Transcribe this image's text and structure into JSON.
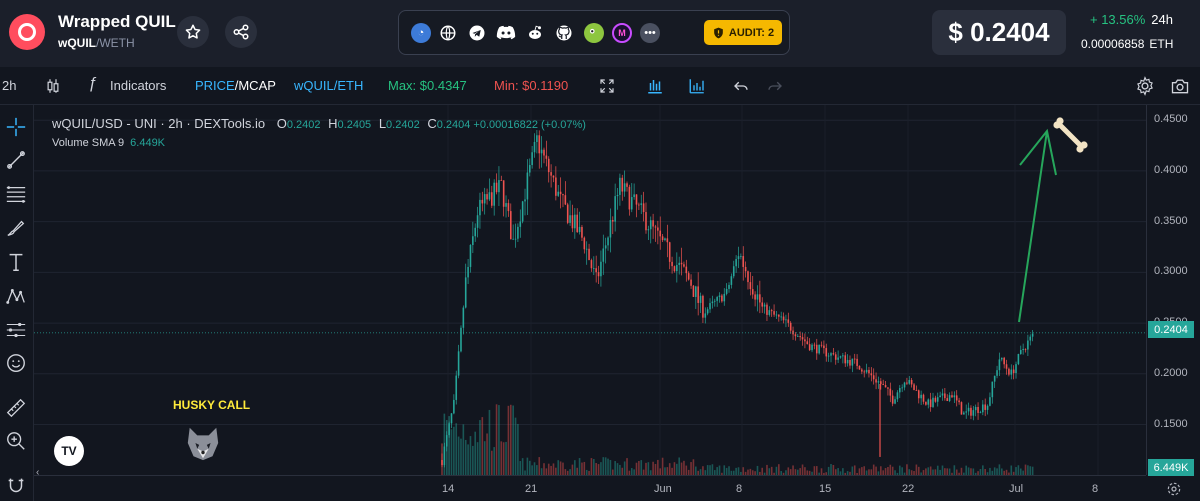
{
  "header": {
    "token_name": "Wrapped QUIL",
    "base_symbol": "wQUIL",
    "separator": "/",
    "quote_symbol": "WETH",
    "audit_label": "AUDIT: 2",
    "price": "$ 0.2404",
    "change": "+ 13.56%",
    "change_period": "24h",
    "eth_price": "0.00006858",
    "eth_symbol": "ETH",
    "social_icons": [
      "dextools-icon",
      "globe-icon",
      "telegram-icon",
      "discord-icon",
      "reddit-icon",
      "github-icon",
      "coingecko-icon",
      "dapp-icon",
      "more-icon"
    ]
  },
  "toolbar": {
    "interval": "2h",
    "indicators_label": "Indicators",
    "price_label": "PRICE",
    "mcap_label": "/MCAP",
    "pair_label": "wQUIL/ETH",
    "max_label": "Max: $0.4347",
    "min_label": "Min: $0.1190"
  },
  "legend": {
    "title": "wQUIL/USD - UNI · 2h · DEXTools.io",
    "o_label": "O",
    "o_value": "0.2402",
    "h_label": "H",
    "h_value": "0.2405",
    "l_label": "L",
    "l_value": "0.2402",
    "c_label": "C",
    "c_value": "0.2404 +0.00016822 (+0.07%)",
    "volume_label": "Volume SMA 9",
    "volume_value": "6.449K"
  },
  "annotation": {
    "husky_text": "HUSKY CALL"
  },
  "colors": {
    "up": "#26a69a",
    "down": "#ef5350",
    "accent": "#26c281",
    "audit": "#f5b800",
    "price_label_blue": "#38b6ff"
  },
  "chart_data": {
    "type": "candlestick",
    "y_ticks": [
      "0.4500",
      "0.4000",
      "0.3500",
      "0.3000",
      "0.2500",
      "0.2000",
      "0.1500"
    ],
    "ylim": [
      0.115,
      0.465
    ],
    "x_ticks": [
      "14",
      "21",
      "Jun",
      "8",
      "15",
      "22",
      "Jul",
      "8"
    ],
    "current_price_label": "0.2404",
    "current_price": 0.2404,
    "volume_label": "6.449K",
    "approx_close_path": [
      [
        "May 12",
        0.115
      ],
      [
        "May 13",
        0.17
      ],
      [
        "May 14",
        0.29
      ],
      [
        "May 15",
        0.36
      ],
      [
        "May 17",
        0.385
      ],
      [
        "May 18",
        0.33
      ],
      [
        "May 19",
        0.38
      ],
      [
        "May 20",
        0.43
      ],
      [
        "May 22",
        0.37
      ],
      [
        "May 24",
        0.33
      ],
      [
        "May 25",
        0.29
      ],
      [
        "May 27",
        0.385
      ],
      [
        "May 29",
        0.355
      ],
      [
        "May 31",
        0.32
      ],
      [
        "Jun 2",
        0.29
      ],
      [
        "Jun 3",
        0.26
      ],
      [
        "Jun 5",
        0.28
      ],
      [
        "Jun 6",
        0.32
      ],
      [
        "Jun 8",
        0.265
      ],
      [
        "Jun 10",
        0.25
      ],
      [
        "Jun 12",
        0.228
      ],
      [
        "Jun 14",
        0.218
      ],
      [
        "Jun 16",
        0.21
      ],
      [
        "Jun 18",
        0.19
      ],
      [
        "Jun 19",
        0.175
      ],
      [
        "Jun 20",
        0.195
      ],
      [
        "Jun 22",
        0.17
      ],
      [
        "Jun 24",
        0.18
      ],
      [
        "Jun 25",
        0.16
      ],
      [
        "Jun 27",
        0.17
      ],
      [
        "Jun 28",
        0.215
      ],
      [
        "Jun 29",
        0.2
      ],
      [
        "Jun 30",
        0.225
      ],
      [
        "Jul 1",
        0.2404
      ]
    ]
  }
}
